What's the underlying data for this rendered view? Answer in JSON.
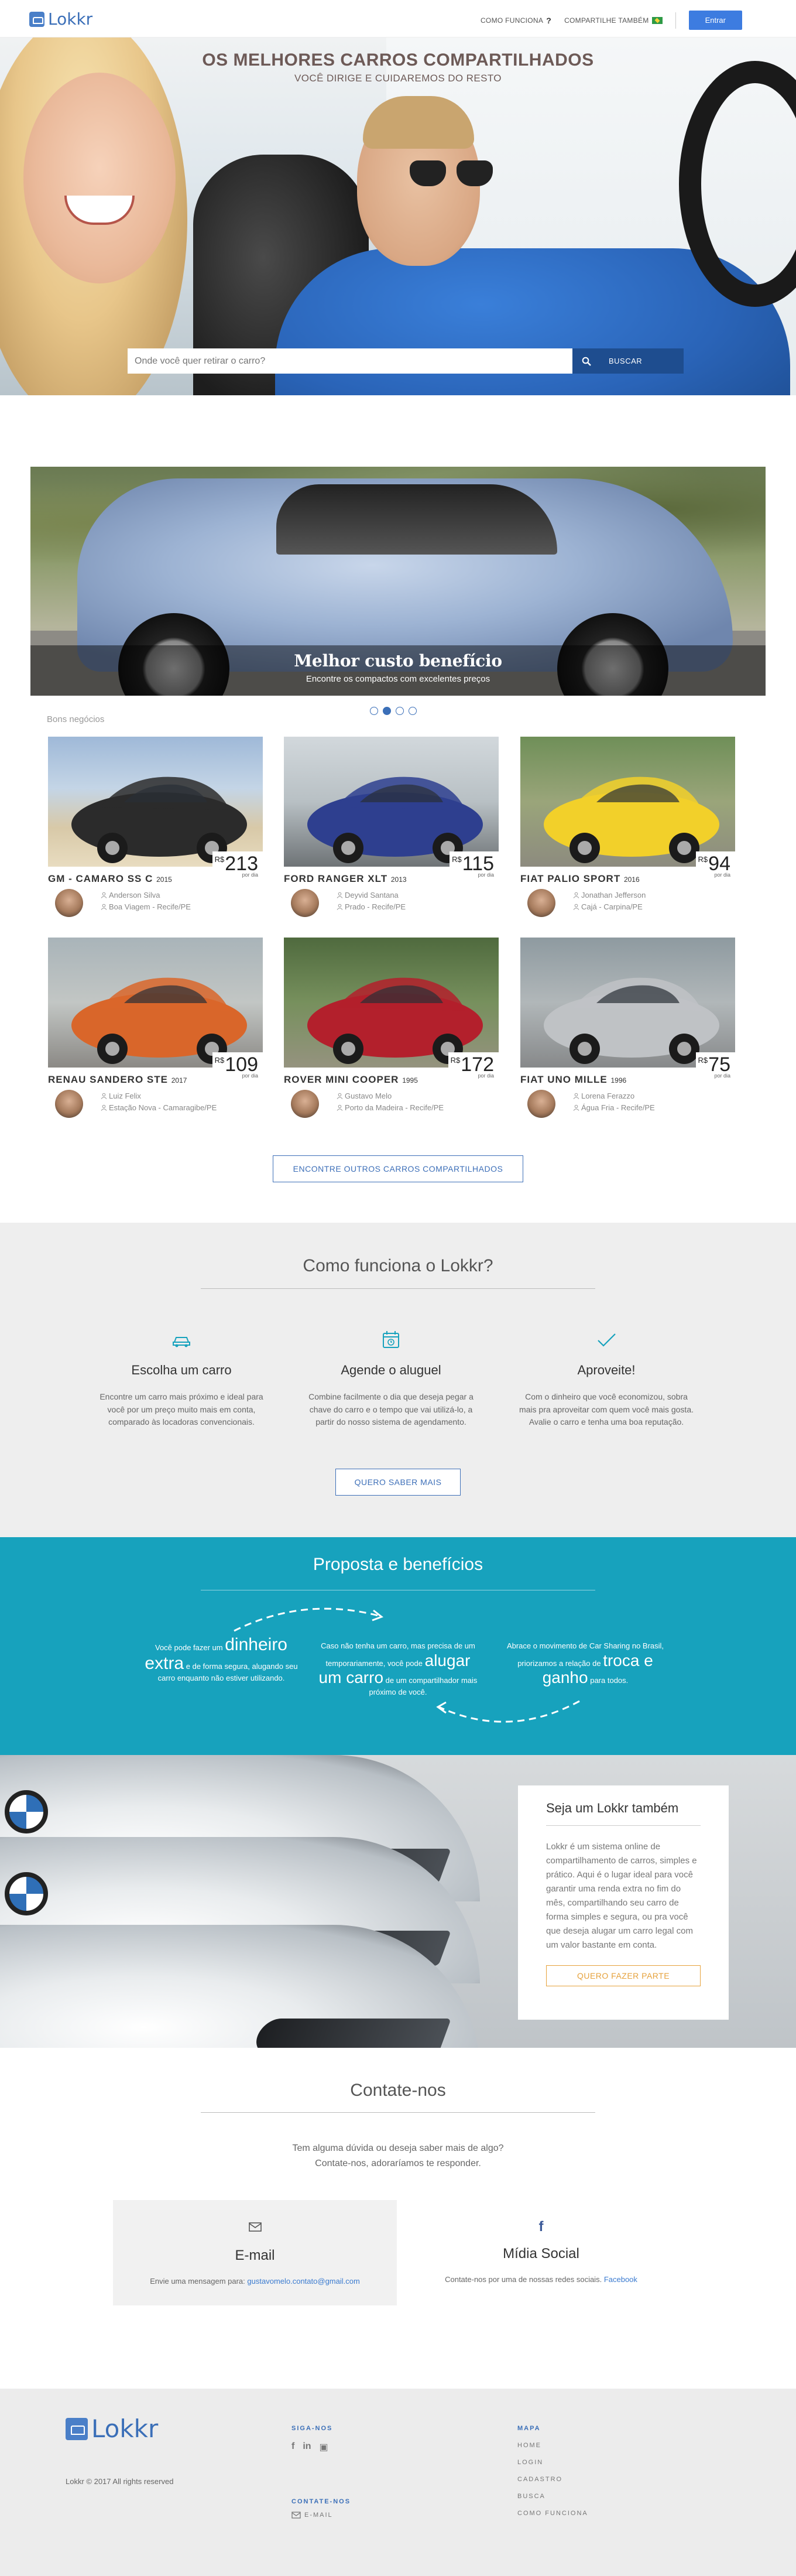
{
  "nav": {
    "brand": "Lokkr",
    "how_it_works": "COMO FUNCIONA",
    "share_too": "COMPARTILHE TAMBÉM",
    "login": "Entrar"
  },
  "hero": {
    "title": "OS MELHORES CARROS COMPARTILHADOS",
    "subtitle": "VOCÊ DIRIGE E CUIDAREMOS DO RESTO",
    "search_placeholder": "Onde você quer retirar o carro?",
    "search_button": "BUSCAR"
  },
  "carousel": {
    "title": "Melhor custo benefício",
    "subtitle": "Encontre os compactos com excelentes preços",
    "slides": 4,
    "active_slide": 2
  },
  "deals": {
    "label": "Bons negócios",
    "items": [
      {
        "name": "GM - CAMARO SS C",
        "year": "2015",
        "currency": "R$",
        "price": "213",
        "per": "por dia",
        "owner": "Anderson Silva",
        "location": "Boa Viagem - Recife/PE",
        "color": "#2b2b2b"
      },
      {
        "name": "FORD RANGER XLT",
        "year": "2013",
        "currency": "R$",
        "price": "115",
        "per": "por dia",
        "owner": "Deyvid Santana",
        "location": "Prado - Recife/PE",
        "color": "#2e3f8f"
      },
      {
        "name": "FIAT PALIO SPORT",
        "year": "2016",
        "currency": "R$",
        "price": "94",
        "per": "por dia",
        "owner": "Jonathan Jefferson",
        "location": "Cajá - Carpina/PE",
        "color": "#f2d02a"
      },
      {
        "name": "RENAU SANDERO STE",
        "year": "2017",
        "currency": "R$",
        "price": "109",
        "per": "por dia",
        "owner": "Luiz Felix",
        "location": "Estação Nova - Camaragibe/PE",
        "color": "#d9662a"
      },
      {
        "name": "ROVER MINI COOPER",
        "year": "1995",
        "currency": "R$",
        "price": "172",
        "per": "por dia",
        "owner": "Gustavo Melo",
        "location": "Porto da Madeira - Recife/PE",
        "color": "#b3202c"
      },
      {
        "name": "FIAT UNO MILLE",
        "year": "1996",
        "currency": "R$",
        "price": "75",
        "per": "por dia",
        "owner": "Lorena Ferazzo",
        "location": "Água Fria - Recife/PE",
        "color": "#bfc2c5"
      }
    ],
    "more_button": "ENCONTRE OUTROS CARROS COMPARTILHADOS"
  },
  "how": {
    "title": "Como funciona o Lokkr?",
    "steps": [
      {
        "title": "Escolha um carro",
        "text": "Encontre um carro mais próximo e ideal para você por um preço muito mais em conta, comparado às locadoras convencionais.",
        "icon": "car-icon"
      },
      {
        "title": "Agende o aluguel",
        "text": "Combine facilmente o dia que deseja pegar a chave do carro e o tempo que vai utilizá-lo, a partir do nosso sistema de agendamento.",
        "icon": "calendar-icon"
      },
      {
        "title": "Aproveite!",
        "text": "Com o dinheiro que você economizou, sobra mais pra aproveitar com quem você mais gosta. Avalie o carro e tenha uma boa reputação.",
        "icon": "check-icon"
      }
    ],
    "more_button": "QUERO SABER MAIS"
  },
  "benefits": {
    "title": "Proposta e benefícios",
    "col1_pre": "Você pode fazer um",
    "col1_big": "dinheiro extra",
    "col1_post": "e de forma segura, alugando seu carro enquanto não estiver utilizando.",
    "col2_pre": "Caso não tenha um carro, mas precisa de um temporariamente, você pode",
    "col2_big": "alugar um carro",
    "col2_post": "de um compartilhador mais próximo de você.",
    "col3_pre": "Abrace o movimento de Car Sharing no Brasil, priorizamos a relação de",
    "col3_big": "troca e ganho",
    "col3_post": "para todos."
  },
  "be_lokkr": {
    "title": "Seja um Lokkr também",
    "text": "Lokkr é um sistema online de compartilhamento de carros, simples e prático. Aqui é o lugar ideal para você garantir uma renda extra no fim do mês, compartilhando seu carro de forma simples e segura, ou pra você que deseja alugar um carro legal com um valor bastante em conta.",
    "button": "QUERO FAZER PARTE"
  },
  "contact": {
    "title": "Contate-nos",
    "line1": "Tem alguma dúvida ou deseja saber mais de algo?",
    "line2": "Contate-nos, adoraríamos te responder.",
    "email_title": "E-mail",
    "email_text": "Envie uma mensagem para:",
    "email_address": "gustavomelo.contato@gmail.com",
    "social_title": "Mídia Social",
    "social_text": "Contate-nos por uma de nossas redes sociais.",
    "social_link": "Facebook"
  },
  "footer": {
    "brand": "Lokkr",
    "copyright": "Lokkr © 2017 All rights reserved",
    "follow_head": "SIGA-NOS",
    "contact_head": "CONTATE-NOS",
    "email_label": "E-MAIL",
    "map_head": "MAPA",
    "menu": [
      "HOME",
      "LOGIN",
      "CADASTRO",
      "BUSCA",
      "COMO FUNCIONA"
    ]
  }
}
